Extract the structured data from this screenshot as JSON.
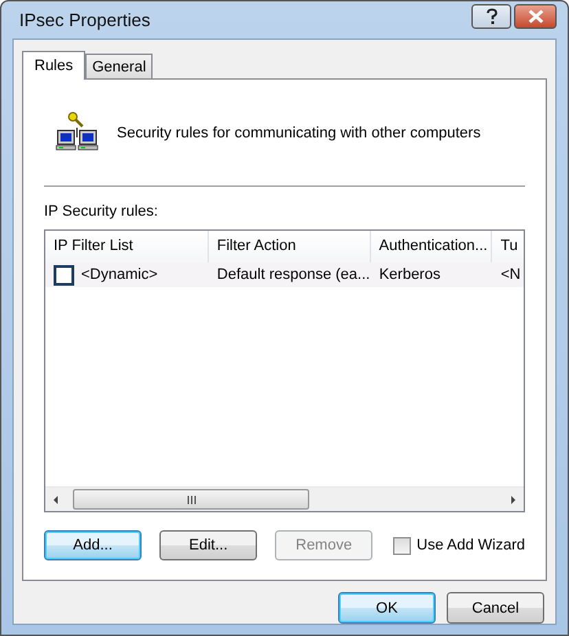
{
  "window": {
    "title": "IPsec Properties"
  },
  "tabs": [
    {
      "label": "Rules",
      "selected": true
    },
    {
      "label": "General",
      "selected": false
    }
  ],
  "description": "Security rules for communicating with other computers",
  "rules_label": "IP Security rules:",
  "table": {
    "columns": [
      "IP Filter List",
      "Filter Action",
      "Authentication...",
      "Tu"
    ],
    "rows": [
      {
        "checked": false,
        "cells": [
          "<Dynamic>",
          "Default response (ea...",
          "Kerberos",
          "<N"
        ]
      }
    ]
  },
  "buttons": [
    {
      "label": "Add...",
      "default": true,
      "disabled": false
    },
    {
      "label": "Edit...",
      "default": false,
      "disabled": false
    },
    {
      "label": "Remove",
      "default": false,
      "disabled": true
    }
  ],
  "wizard": {
    "label": "Use Add Wizard",
    "checked": false
  },
  "dialog_buttons": [
    {
      "label": "OK",
      "default": true
    },
    {
      "label": "Cancel",
      "default": false
    }
  ]
}
